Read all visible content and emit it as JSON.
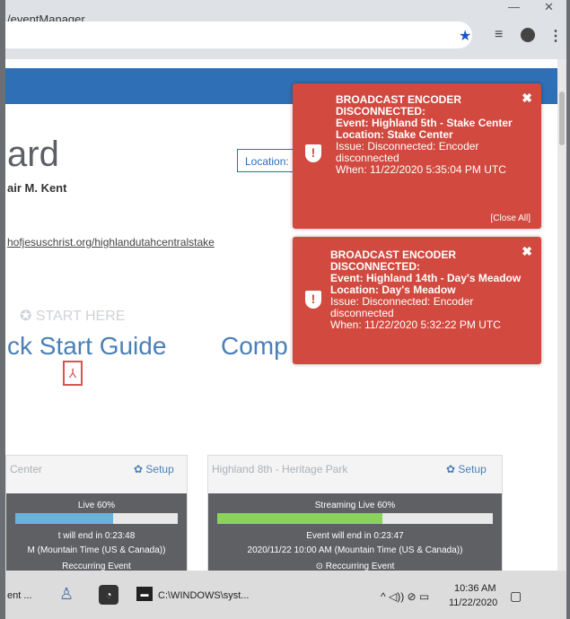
{
  "browser": {
    "tab_title": "/eventManager",
    "star_icon": "★",
    "list_icon": "≡",
    "account_icon": "●",
    "more_icon": "⋮",
    "min_icon": "—",
    "close_icon": "✕"
  },
  "page": {
    "title": "ard",
    "user_name": "air M. Kent",
    "location_button": "Location:",
    "url": "hofjesuschrist.org/highlandutahcentralstake",
    "start_here": "✪ START HERE",
    "quick_start": "ck Start Guide",
    "complete_guide": "Comp",
    "pdf_icon": "⅄"
  },
  "cards": [
    {
      "title": "Center",
      "setup": "✿ Setup",
      "bar_label": "Live 60%",
      "progress": 0.6,
      "end_text": "t will end in 0:23:48",
      "date_text": "M (Mountain Time (US & Canada))",
      "recur_text": "Reccurring Event"
    },
    {
      "title": "Highland 8th - Heritage Park",
      "setup": "✿ Setup",
      "bar_label": "Streaming Live 60%",
      "progress": 0.6,
      "end_text": "Event will end in 0:23:47",
      "date_text": "2020/11/22 10:00 AM (Mountain Time (US & Canada))",
      "recur_text": "⊙ Reccurring Event"
    }
  ],
  "alerts": [
    {
      "line1": "BROADCAST ENCODER",
      "line2": "DISCONNECTED:",
      "event": "Event: Highland 5th - Stake Center",
      "location": "Location: Stake Center",
      "issue": "Issue: Disconnected: Encoder disconnected",
      "when": "When: 11/22/2020 5:35:04 PM UTC",
      "close_all": "[Close All]",
      "close": "✖",
      "shield": "!"
    },
    {
      "line1": "BROADCAST ENCODER",
      "line2": "DISCONNECTED:",
      "event": "Event: Highland 14th - Day's Meadow",
      "location": "Location: Day's Meadow",
      "issue": "Issue: Disconnected: Encoder disconnected",
      "when": "When: 11/22/2020 5:32:22 PM UTC",
      "close": "✖",
      "shield": "!"
    }
  ],
  "taskbar": {
    "app1": "ent ...",
    "app3": "C:\\WINDOWS\\syst...",
    "time": "10:36 AM",
    "date": "11/22/2020",
    "tray": "^ ◁)) ⊘ ▭",
    "notify": "▢",
    "app2_icon": "◔",
    "cmd_icon": "▬"
  }
}
